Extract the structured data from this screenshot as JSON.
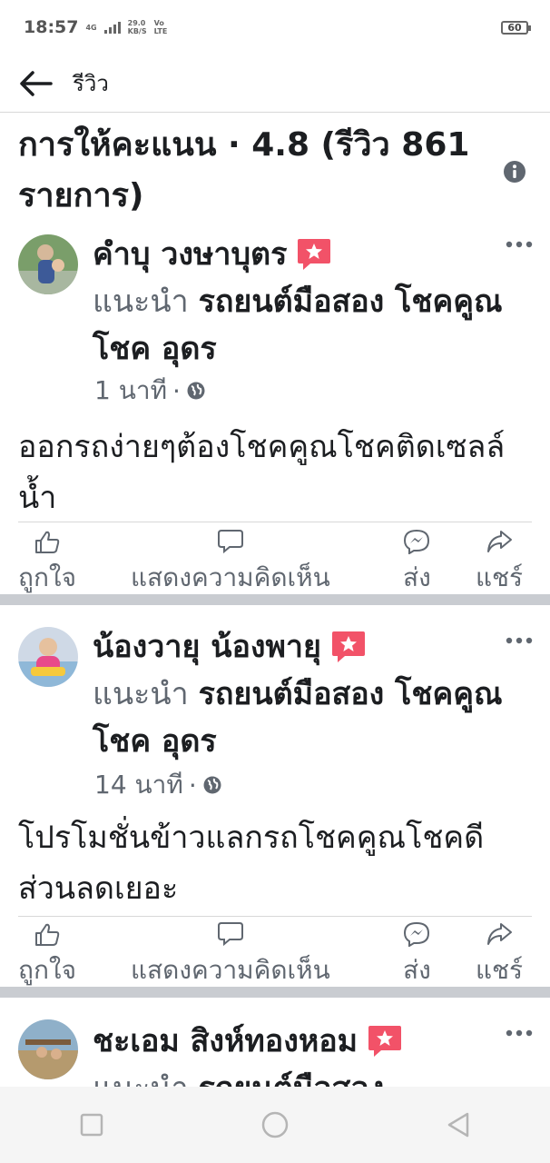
{
  "status_bar": {
    "time": "18:57",
    "network_type": "4G",
    "speed_value": "29.0",
    "speed_unit": "KB/S",
    "volte_top": "Vo",
    "volte_bottom": "LTE",
    "battery": "60"
  },
  "header": {
    "title": "รีวิว"
  },
  "rating": {
    "heading": "การให้คะแนน · 4.8 (รีวิว 861 รายการ)"
  },
  "reviews": [
    {
      "name": "คำบุ วงษาบุตร",
      "recommend_verb": "แนะนำ",
      "page_name": "รถยนต์มือสอง โชคคูณโชค อุดร",
      "time": "1 นาที",
      "text": "ออกรถง่ายๆต้องโชคคูณโชคติดเซลล์น้ำ"
    },
    {
      "name": "น้องวายุ น้องพายุ",
      "recommend_verb": "แนะนำ",
      "page_name": "รถยนต์มือสอง โชคคูณโชค อุดร",
      "time": "14 นาที",
      "text": "โปรโมชั่นข้าวแลกรถโชคคูณโชคดีส่วนลดเยอะ"
    },
    {
      "name": "ชะเอม สิงห์ทองหอม",
      "recommend_verb": "แนะนำ",
      "page_name": "รถยนต์มือสอง"
    }
  ],
  "actions": {
    "like": "ถูกใจ",
    "comment": "แสดงความคิดเห็น",
    "send": "ส่ง",
    "share": "แชร์"
  },
  "colors": {
    "badge": "#f25268",
    "secondary_text": "#606770",
    "separator": "#c9ccd1"
  },
  "icons": [
    "back-arrow-icon",
    "info-icon",
    "recommend-badge-icon",
    "more-icon",
    "globe-icon",
    "like-icon",
    "comment-icon",
    "messenger-icon",
    "share-icon"
  ]
}
